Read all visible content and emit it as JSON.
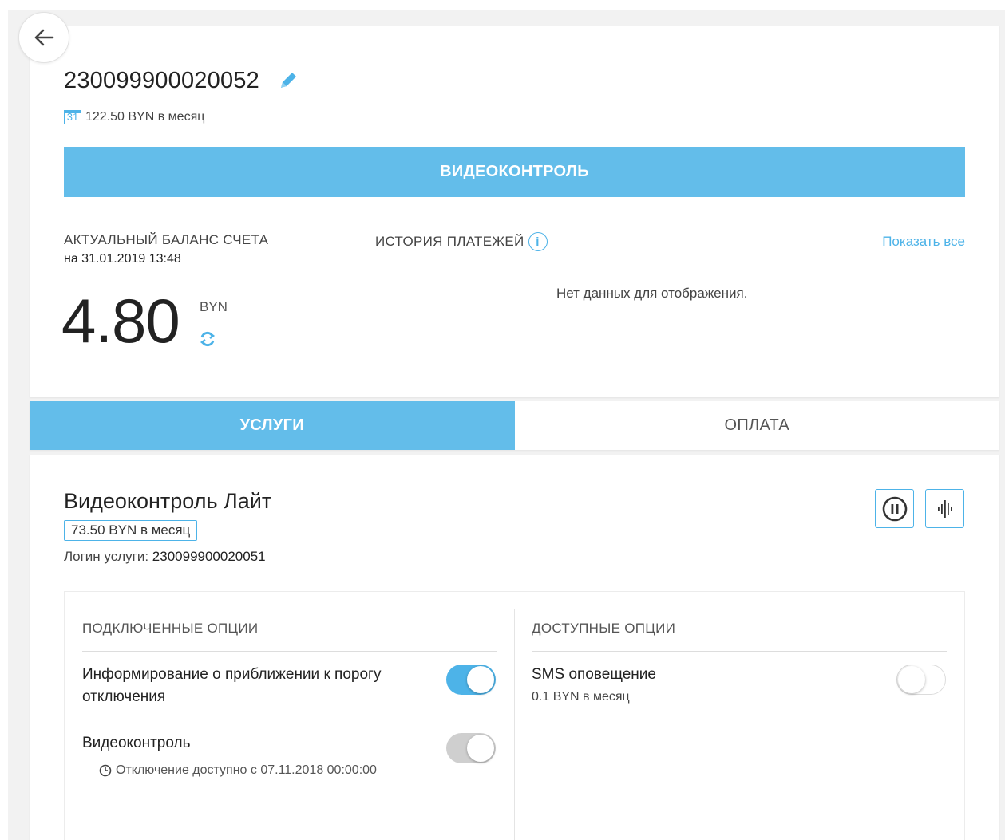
{
  "header": {
    "account_number": "230099900020052",
    "monthly_fee": "122.50 BYN в месяц",
    "calendar_day": "31",
    "service_banner": "ВИДЕОКОНТРОЛЬ"
  },
  "balance": {
    "label": "АКТУАЛЬНЫЙ БАЛАНС СЧЕТА",
    "date": "на 31.01.2019 13:48",
    "amount": "4.80",
    "currency": "BYN"
  },
  "history": {
    "label": "ИСТОРИЯ ПЛАТЕЖЕЙ",
    "info_glyph": "i",
    "show_all": "Показать все",
    "empty_text": "Нет данных для отображения."
  },
  "tabs": [
    {
      "label": "УСЛУГИ",
      "active": true
    },
    {
      "label": "ОПЛАТА",
      "active": false
    }
  ],
  "service": {
    "title": "Видеоконтроль Лайт",
    "price": "73.50 BYN в месяц",
    "login_label": "Логин услуги: ",
    "login_value": "230099900020051"
  },
  "connected_options": {
    "title": "ПОДКЛЮЧЕННЫЕ ОПЦИИ",
    "items": [
      {
        "name": "Информирование о приближении к порогу отключения",
        "state": "on"
      },
      {
        "name": "Видеоконтроль",
        "state": "disabled-on",
        "note": "Отключение доступно с 07.11.2018 00:00:00"
      }
    ]
  },
  "available_options": {
    "title": "ДОСТУПНЫЕ ОПЦИИ",
    "items": [
      {
        "name": "SMS оповещение",
        "price": "0.1 BYN в месяц",
        "state": "off"
      }
    ]
  },
  "colors": {
    "accent": "#63bdea",
    "accent_dark": "#4db3e8"
  }
}
